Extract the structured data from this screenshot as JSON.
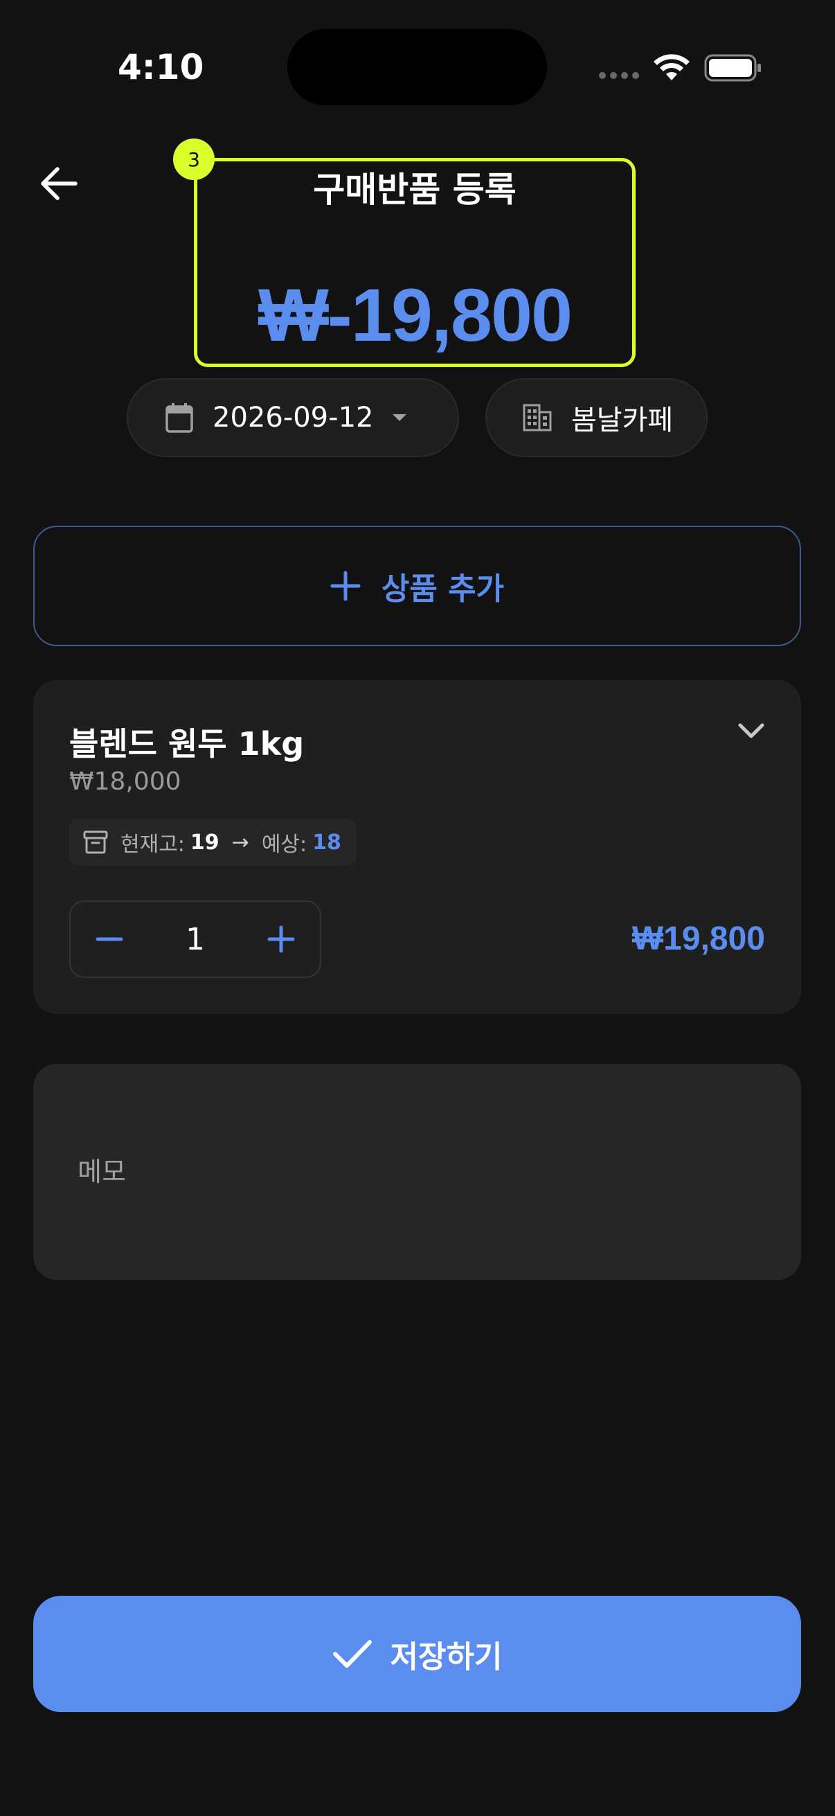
{
  "status_bar": {
    "time": "4:10"
  },
  "header": {
    "title": "구매반품 등록",
    "total_amount": "₩-19,800",
    "highlight_badge": "3"
  },
  "filters": {
    "date": "2026-09-12",
    "store": "봄날카페"
  },
  "add_product": {
    "label": "상품 추가"
  },
  "product": {
    "name": "블렌드 원두 1kg",
    "price": "₩18,000",
    "stock_label": "현재고:",
    "stock_value": "19",
    "arrow": "→",
    "expected_label": "예상:",
    "expected_value": "18",
    "quantity": "1",
    "line_total": "₩19,800"
  },
  "memo": {
    "placeholder": "메모",
    "value": ""
  },
  "save": {
    "label": "저장하기"
  },
  "colors": {
    "background": "#121212",
    "accent": "#5b8dee",
    "card": "#1f1f1f",
    "highlight": "#d7ff2a"
  },
  "icons": {
    "back": "arrow-left-icon",
    "calendar": "calendar-icon",
    "dropdown": "caret-down-icon",
    "store": "building-icon",
    "add": "plus-icon",
    "expand": "chevron-down-icon",
    "stock": "archive-box-icon",
    "decrement": "minus-icon",
    "increment": "plus-icon",
    "save": "check-icon"
  }
}
